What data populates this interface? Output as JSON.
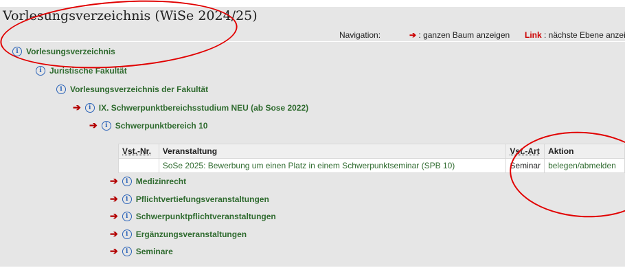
{
  "page": {
    "title": "Vorlesungsverzeichnis (WiSe 2024/25)"
  },
  "navigation": {
    "label": "Navigation:",
    "arrow_hint": ": ganzen Baum anzeigen",
    "link_word": "Link",
    "link_hint": ": nächste Ebene anzeigen"
  },
  "tree": [
    {
      "label": "Vorlesungsverzeichnis",
      "arrow": false
    },
    {
      "label": "Juristische Fakultät",
      "arrow": false
    },
    {
      "label": "Vorlesungsverzeichnis der Fakultät",
      "arrow": false
    },
    {
      "label": "IX. Schwerpunktbereichsstudium NEU (ab Sose 2022)",
      "arrow": true
    },
    {
      "label": "Schwerpunktbereich 10",
      "arrow": true
    }
  ],
  "table": {
    "headers": {
      "nr": "Vst.-Nr.",
      "title": "Veranstaltung",
      "type": "Vst.-Art",
      "action": "Aktion"
    },
    "rows": [
      {
        "nr": "",
        "title": "SoSe 2025: Bewerbung um einen Platz in einem Schwerpunktseminar (SPB 10)",
        "type": "Seminar",
        "action": "belegen/abmelden"
      }
    ]
  },
  "subitems": [
    {
      "label": "Medizinrecht"
    },
    {
      "label": "Pflichtvertiefungsveranstaltungen"
    },
    {
      "label": "Schwerpunktpflichtveranstaltungen"
    },
    {
      "label": "Ergänzungsveranstaltungen"
    },
    {
      "label": "Seminare"
    }
  ],
  "colors": {
    "link_green": "#2f6b2f",
    "arrow_red": "#b30000",
    "info_blue": "#2a63b8",
    "annotation_red": "#e10000"
  },
  "icons": {
    "info": "info-circle-icon",
    "arrow": "right-arrow-icon"
  }
}
